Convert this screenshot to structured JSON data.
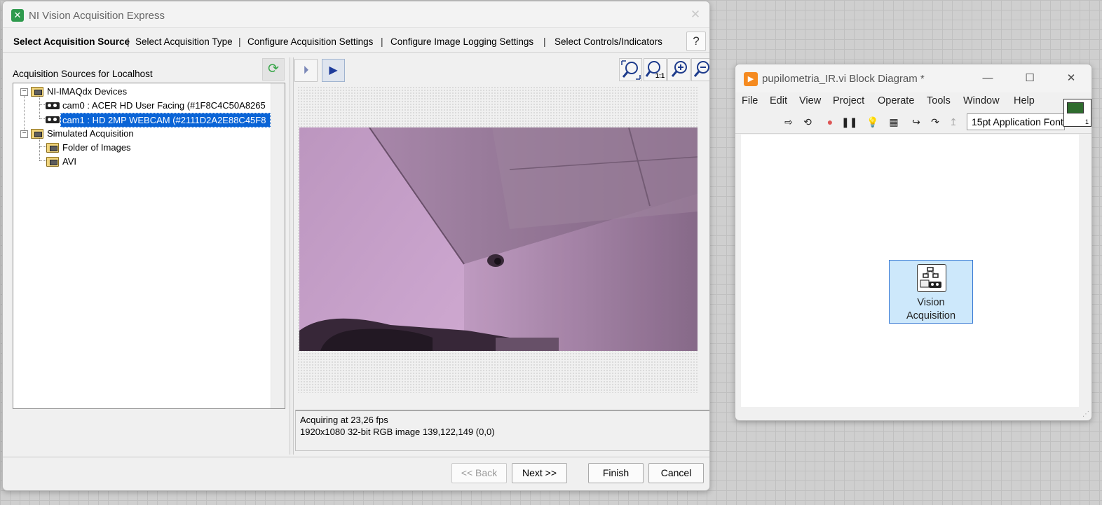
{
  "nix": {
    "title": "NI Vision Acquisition Express",
    "steps": [
      "Select Acquisition Source",
      "Select Acquisition Type",
      "Configure Acquisition Settings",
      "Configure Image Logging Settings",
      "Select Controls/Indicators"
    ],
    "help": "?",
    "sources_label": "Acquisition Sources for Localhost",
    "tree": {
      "imaqdx": "NI-IMAQdx Devices",
      "cam0": "cam0 : ACER HD User Facing  (#1F8C4C50A8265",
      "cam1": "cam1 : HD 2MP WEBCAM  (#2111D2A2E88C45F8",
      "simulated": "Simulated Acquisition",
      "folder": "Folder of Images",
      "avi": "AVI"
    },
    "status": {
      "fps": "Acquiring at 23,26 fps",
      "image_info": "1920x1080 32-bit RGB image 139,122,149    (0,0)"
    },
    "buttons": {
      "back": "<< Back",
      "next": "Next >>",
      "finish": "Finish",
      "cancel": "Cancel"
    },
    "zoom_1to1_label": "1:1"
  },
  "bd": {
    "title": "pupilometria_IR.vi Block Diagram *",
    "menus": [
      "File",
      "Edit",
      "View",
      "Project",
      "Operate",
      "Tools",
      "Window",
      "Help"
    ],
    "font": "15pt Application Font",
    "vi_icon_number": "1",
    "node_label_line1": "Vision",
    "node_label_line2": "Acquisition"
  },
  "icons": {
    "app": "vision-acquisition-icon",
    "refresh": "refresh-icon",
    "zoom_fit": "zoom-to-fit-icon",
    "zoom_1to1": "zoom-1to1-icon",
    "zoom_in": "zoom-in-icon",
    "zoom_out": "zoom-out-icon"
  },
  "colors": {
    "selection": "#0a64d6",
    "node_fill": "#cde8fb",
    "node_border": "#3a7bd5",
    "ir_tint": "#a07ca0"
  }
}
